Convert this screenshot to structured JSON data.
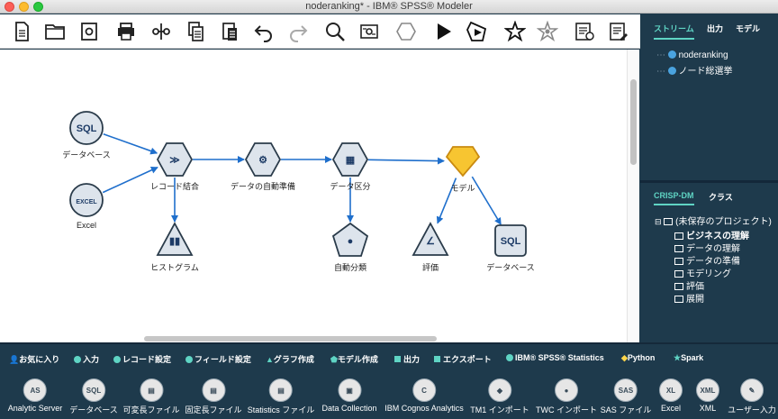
{
  "window": {
    "title": "noderanking* - IBM® SPSS® Modeler"
  },
  "toolbar": [
    "new-stream-icon",
    "open-folder-icon",
    "save-icon",
    "print-icon",
    "cut-icon",
    "copy-icon",
    "paste-icon",
    "undo-icon",
    "redo-icon",
    "search-icon",
    "stream-properties-icon",
    "supernode-icon",
    "run-icon",
    "run-selection-icon",
    "magic-star-icon",
    "preview-star-icon",
    "annotation-icon",
    "comment-icon"
  ],
  "canvas": {
    "nodes": [
      {
        "id": "db1",
        "label": "データベース",
        "shape": "circle",
        "icon": "database-icon",
        "glyph": "SQL"
      },
      {
        "id": "excel",
        "label": "Excel",
        "shape": "circle",
        "icon": "excel-icon",
        "glyph": "EXCEL"
      },
      {
        "id": "merge",
        "label": "レコード結合",
        "shape": "hexagon",
        "icon": "merge-icon",
        "glyph": "≫"
      },
      {
        "id": "autodata",
        "label": "データの自動準備",
        "shape": "hexagon",
        "icon": "auto-data-prep-icon",
        "glyph": "⚙"
      },
      {
        "id": "partition",
        "label": "データ区分",
        "shape": "hexagon",
        "icon": "partition-icon",
        "glyph": "▦"
      },
      {
        "id": "model",
        "label": "モデル",
        "shape": "gem",
        "icon": "model-nugget-icon",
        "glyph": ""
      },
      {
        "id": "histogram",
        "label": "ヒストグラム",
        "shape": "triangle",
        "icon": "histogram-icon",
        "glyph": "▮▮"
      },
      {
        "id": "autocluster",
        "label": "自動分類",
        "shape": "pentagon",
        "icon": "auto-cluster-icon",
        "glyph": "●"
      },
      {
        "id": "eval",
        "label": "評価",
        "shape": "triangle",
        "icon": "evaluation-icon",
        "glyph": "∠"
      },
      {
        "id": "dbexport",
        "label": "データベース",
        "shape": "square",
        "icon": "database-export-icon",
        "glyph": "SQL"
      }
    ],
    "links": [
      [
        "db1",
        "merge"
      ],
      [
        "excel",
        "merge"
      ],
      [
        "merge",
        "autodata"
      ],
      [
        "merge",
        "histogram"
      ],
      [
        "autodata",
        "partition"
      ],
      [
        "partition",
        "model"
      ],
      [
        "partition",
        "autocluster"
      ],
      [
        "model",
        "eval"
      ],
      [
        "model",
        "dbexport"
      ]
    ]
  },
  "right_top": {
    "tabs": [
      "ストリーム",
      "出力",
      "モデル"
    ],
    "active_tab": "ストリーム",
    "tree": [
      "noderanking",
      "ノード総選挙"
    ]
  },
  "right_bottom": {
    "tabs": [
      "CRISP-DM",
      "クラス"
    ],
    "active_tab": "CRISP-DM",
    "root": "(未保存のプロジェクト)",
    "items": [
      "ビジネスの理解",
      "データの理解",
      "データの準備",
      "モデリング",
      "評価",
      "展開"
    ]
  },
  "palette": {
    "tabs": [
      "お気に入り",
      "入力",
      "レコード設定",
      "フィールド設定",
      "グラフ作成",
      "モデル作成",
      "出力",
      "エクスポート",
      "IBM® SPSS® Statistics",
      "Python",
      "Spark"
    ],
    "active_tab": "入力",
    "items": [
      {
        "label": "Analytic Server",
        "glyph": "AS"
      },
      {
        "label": "データベース",
        "glyph": "SQL"
      },
      {
        "label": "可変長ファイル",
        "glyph": "▤"
      },
      {
        "label": "固定長ファイル",
        "glyph": "▤"
      },
      {
        "label": "Statistics ファイル",
        "glyph": "▤"
      },
      {
        "label": "Data Collection",
        "glyph": "▣"
      },
      {
        "label": "IBM Cognos Analytics",
        "glyph": "C"
      },
      {
        "label": "TM1 インポート",
        "glyph": "◆"
      },
      {
        "label": "TWC インポート",
        "glyph": "●"
      },
      {
        "label": "SAS ファイル",
        "glyph": "SAS"
      },
      {
        "label": "Excel",
        "glyph": "XL"
      },
      {
        "label": "XML",
        "glyph": "XML"
      },
      {
        "label": "ユーザー入力",
        "glyph": "✎"
      }
    ]
  },
  "colors": {
    "accent": "#5fd4c4",
    "panel": "#1e3a4c",
    "link": "#1f6fcc",
    "node_fill": "#dde4ec"
  }
}
